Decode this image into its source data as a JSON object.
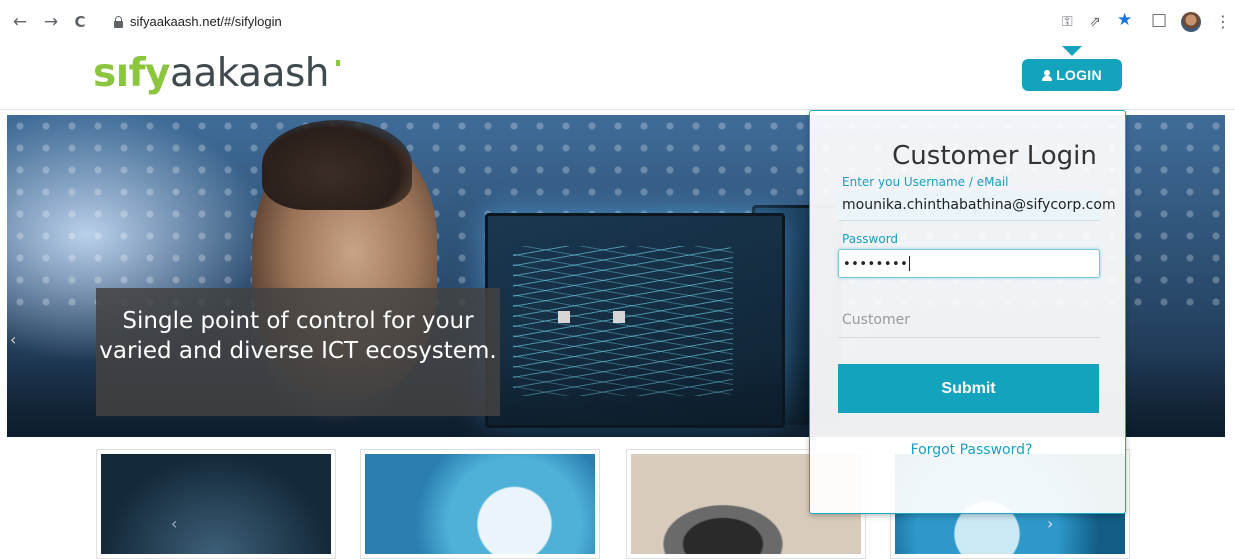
{
  "browser": {
    "url": "sifyaakaash.net/#/sifylogin",
    "back_icon": "←",
    "forward_icon": "→",
    "reload_icon": "C",
    "key_icon": "⚿",
    "share_icon": "⇗",
    "star_icon": "★",
    "sidepanel_icon": "□",
    "menu_icon": "⋮"
  },
  "header": {
    "logo_part1": "sıfy",
    "logo_part2": "aakaash",
    "login_label": "LOGIN"
  },
  "hero": {
    "caption": "Single point of control for your varied and diverse ICT ecosystem.",
    "prev_arrow": "‹",
    "next_arrow": "›"
  },
  "login": {
    "title": "Customer Login",
    "username_label": "Enter you Username / eMail",
    "username_value": "mounika.chinthabathina@sifycorp.com",
    "password_label": "Password",
    "password_value": "••••••••",
    "customer_placeholder": "Customer",
    "submit_label": "Submit",
    "forgot_label": "Forgot Password?"
  },
  "tiles": {
    "tile1_arrow": "‹",
    "tile4_arrow": "›"
  },
  "colors": {
    "accent": "#14a3bd",
    "logo_green": "#8cc63e"
  }
}
